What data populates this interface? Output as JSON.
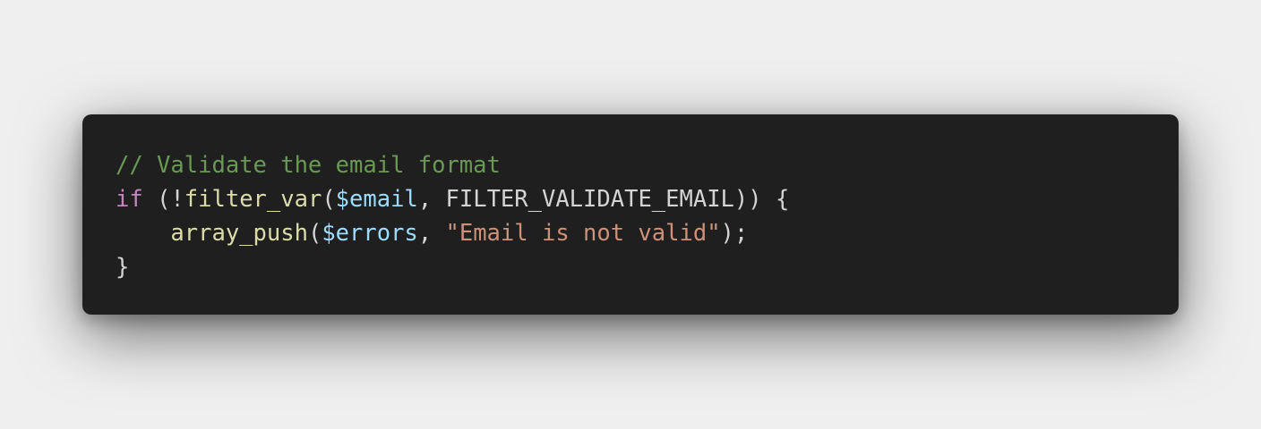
{
  "code": {
    "line1": {
      "comment": "// Validate the email format"
    },
    "line2": {
      "keyword": "if",
      "p1": " (!",
      "func": "filter_var",
      "p2": "(",
      "var": "$email",
      "p3": ", ",
      "const": "FILTER_VALIDATE_EMAIL",
      "p4": ")) {"
    },
    "line3": {
      "indent": "    ",
      "func": "array_push",
      "p1": "(",
      "var": "$errors",
      "p2": ", ",
      "string": "\"Email is not valid\"",
      "p3": ");"
    },
    "line4": {
      "brace": "}"
    }
  },
  "colors": {
    "background": "#efefef",
    "editor": "#1f1f1f",
    "comment": "#6a9955",
    "keyword": "#c586c0",
    "function": "#dcdcaa",
    "variable": "#9cdcfe",
    "string": "#ce9178",
    "text": "#d4d4d4"
  }
}
